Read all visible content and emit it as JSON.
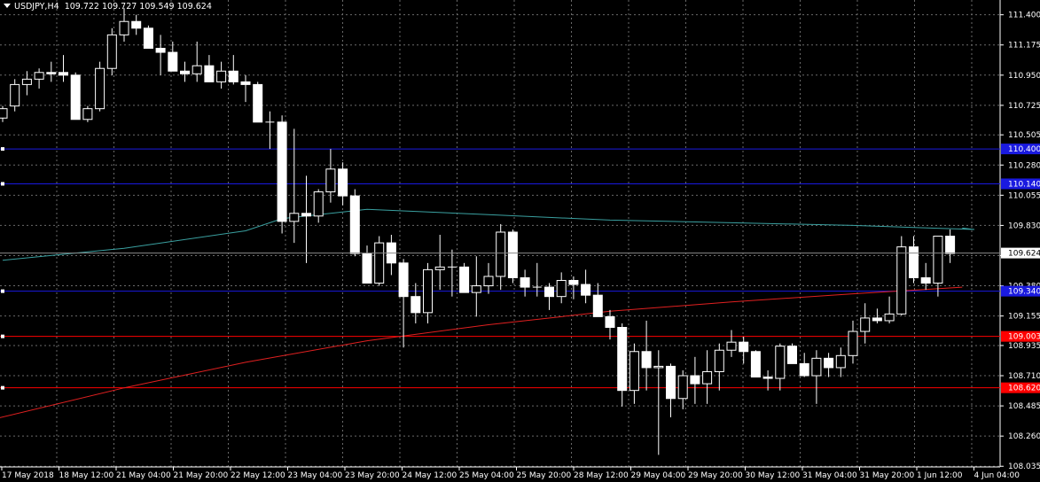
{
  "header": {
    "symbol": "USDJPY,H4",
    "ohlc": "109.722 109.727 109.549 109.624"
  },
  "colors": {
    "background": "#000000",
    "grid": "#6a6a6a",
    "axis_text": "#ffffff",
    "bull": "#000000",
    "bear": "#ffffff",
    "doji_green": "#00c000",
    "ma_cyan": "#3aa0a0",
    "ma_red": "#e02020",
    "level_blue": "#1a1ae0",
    "level_red": "#ff0000",
    "price_marker": "#ffffff"
  },
  "chart_data": {
    "type": "candlestick",
    "current_price": "109.624",
    "y_ticks": [
      "111.400",
      "111.175",
      "110.950",
      "110.725",
      "110.505",
      "110.280",
      "110.055",
      "109.830",
      "109.605",
      "109.380",
      "109.155",
      "108.935",
      "108.710",
      "108.485",
      "108.260",
      "108.035"
    ],
    "ylim": [
      108.03,
      111.51
    ],
    "x_ticks": [
      "17 May 2018",
      "18 May 12:00",
      "21 May 04:00",
      "21 May 20:00",
      "22 May 12:00",
      "23 May 04:00",
      "23 May 20:00",
      "24 May 12:00",
      "25 May 04:00",
      "25 May 20:00",
      "28 May 12:00",
      "29 May 04:00",
      "29 May 20:00",
      "30 May 12:00",
      "31 May 04:00",
      "31 May 20:00",
      "1 Jun 12:00",
      "4 Jun 04:00"
    ],
    "levels": [
      {
        "price": 110.4,
        "label": "110.400",
        "color": "blue"
      },
      {
        "price": 110.14,
        "label": "110.140",
        "color": "blue"
      },
      {
        "price": 109.34,
        "label": "109.340",
        "color": "blue"
      },
      {
        "price": 109.003,
        "label": "109.003",
        "color": "red"
      },
      {
        "price": 108.62,
        "label": "108.620",
        "color": "red"
      }
    ],
    "ma_cyan": [
      [
        0,
        109.57
      ],
      [
        10,
        109.66
      ],
      [
        20,
        109.79
      ],
      [
        23,
        109.88
      ],
      [
        30,
        109.95
      ],
      [
        40,
        109.91
      ],
      [
        50,
        109.87
      ],
      [
        60,
        109.85
      ],
      [
        70,
        109.83
      ],
      [
        80,
        109.8
      ],
      [
        79,
        109.81
      ]
    ],
    "ma_red": [
      [
        -1,
        108.38
      ],
      [
        10,
        108.62
      ],
      [
        20,
        108.81
      ],
      [
        30,
        108.97
      ],
      [
        40,
        109.09
      ],
      [
        50,
        109.19
      ],
      [
        60,
        109.26
      ],
      [
        70,
        109.32
      ],
      [
        79,
        109.37
      ]
    ],
    "candles": [
      [
        110.63,
        110.72,
        110.6,
        110.7
      ],
      [
        110.72,
        110.92,
        110.68,
        110.88
      ],
      [
        110.88,
        110.98,
        110.8,
        110.92
      ],
      [
        110.92,
        111.0,
        110.85,
        110.97
      ],
      [
        110.97,
        111.05,
        110.9,
        110.96
      ],
      [
        110.97,
        111.1,
        110.9,
        110.95
      ],
      [
        110.95,
        110.97,
        110.62,
        110.62
      ],
      [
        110.62,
        110.72,
        110.6,
        110.7
      ],
      [
        110.7,
        111.05,
        110.68,
        111.0
      ],
      [
        111.0,
        111.3,
        110.95,
        111.25
      ],
      [
        111.25,
        111.45,
        111.2,
        111.35
      ],
      [
        111.35,
        111.4,
        111.25,
        111.3
      ],
      [
        111.3,
        111.32,
        111.15,
        111.15
      ],
      [
        111.15,
        111.25,
        110.95,
        111.12
      ],
      [
        111.12,
        111.2,
        111.0,
        110.98
      ],
      [
        110.98,
        111.05,
        110.9,
        110.96
      ],
      [
        110.96,
        111.2,
        110.9,
        111.02
      ],
      [
        111.02,
        111.1,
        110.9,
        110.9
      ],
      [
        110.9,
        111.05,
        110.85,
        110.98
      ],
      [
        110.98,
        111.1,
        110.88,
        110.9
      ],
      [
        110.9,
        110.95,
        110.75,
        110.88
      ],
      [
        110.88,
        110.9,
        110.6,
        110.6
      ],
      [
        110.6,
        110.68,
        110.4,
        110.6
      ],
      [
        110.6,
        110.65,
        109.77,
        109.86
      ],
      [
        109.86,
        110.55,
        109.7,
        109.92
      ],
      [
        109.92,
        110.2,
        109.55,
        109.9
      ],
      [
        109.9,
        110.1,
        109.85,
        110.08
      ],
      [
        110.08,
        110.4,
        110.0,
        110.25
      ],
      [
        110.25,
        110.3,
        109.98,
        110.05
      ],
      [
        110.05,
        110.1,
        109.6,
        109.62
      ],
      [
        109.62,
        109.68,
        109.4,
        109.4
      ],
      [
        109.4,
        109.75,
        109.38,
        109.7
      ],
      [
        109.7,
        109.76,
        109.46,
        109.55
      ],
      [
        109.55,
        109.58,
        108.92,
        109.3
      ],
      [
        109.3,
        109.4,
        109.1,
        109.18
      ],
      [
        109.18,
        109.55,
        109.1,
        109.5
      ],
      [
        109.5,
        109.76,
        109.35,
        109.52
      ],
      [
        109.52,
        109.65,
        109.3,
        109.52
      ],
      [
        109.52,
        109.55,
        109.35,
        109.33
      ],
      [
        109.33,
        109.6,
        109.15,
        109.38
      ],
      [
        109.38,
        109.55,
        109.32,
        109.45
      ],
      [
        109.45,
        109.84,
        109.35,
        109.78
      ],
      [
        109.78,
        109.8,
        109.4,
        109.44
      ],
      [
        109.44,
        109.5,
        109.3,
        109.37
      ],
      [
        109.37,
        109.55,
        109.3,
        109.37
      ],
      [
        109.37,
        109.4,
        109.2,
        109.3
      ],
      [
        109.3,
        109.48,
        109.25,
        109.42
      ],
      [
        109.42,
        109.45,
        109.28,
        109.39
      ],
      [
        109.39,
        109.5,
        109.25,
        109.31
      ],
      [
        109.31,
        109.4,
        109.15,
        109.15
      ],
      [
        109.15,
        109.2,
        108.98,
        109.07
      ],
      [
        109.07,
        109.1,
        108.48,
        108.6
      ],
      [
        108.6,
        108.95,
        108.5,
        108.89
      ],
      [
        108.89,
        109.12,
        108.6,
        108.77
      ],
      [
        108.77,
        108.9,
        108.12,
        108.78
      ],
      [
        108.78,
        108.8,
        108.4,
        108.54
      ],
      [
        108.54,
        108.75,
        108.46,
        108.71
      ],
      [
        108.71,
        108.85,
        108.5,
        108.65
      ],
      [
        108.65,
        108.9,
        108.5,
        108.74
      ],
      [
        108.74,
        108.95,
        108.6,
        108.9
      ],
      [
        108.9,
        109.05,
        108.85,
        108.96
      ],
      [
        108.96,
        109.0,
        108.8,
        108.89
      ],
      [
        108.89,
        108.9,
        108.7,
        108.7
      ],
      [
        108.7,
        108.75,
        108.6,
        108.69
      ],
      [
        108.69,
        108.95,
        108.6,
        108.93
      ],
      [
        108.93,
        108.95,
        108.8,
        108.8
      ],
      [
        108.8,
        108.88,
        108.7,
        108.71
      ],
      [
        108.71,
        108.9,
        108.5,
        108.84
      ],
      [
        108.84,
        108.88,
        108.7,
        108.77
      ],
      [
        108.77,
        108.92,
        108.7,
        108.86
      ],
      [
        108.86,
        109.12,
        108.8,
        109.04
      ],
      [
        109.04,
        109.25,
        108.95,
        109.14
      ],
      [
        109.14,
        109.21,
        109.1,
        109.12
      ],
      [
        109.12,
        109.3,
        109.1,
        109.17
      ],
      [
        109.17,
        109.75,
        109.16,
        109.67
      ],
      [
        109.67,
        109.75,
        109.4,
        109.44
      ],
      [
        109.44,
        109.55,
        109.35,
        109.4
      ],
      [
        109.4,
        109.75,
        109.3,
        109.75
      ],
      [
        109.75,
        109.8,
        109.55,
        109.62
      ]
    ]
  }
}
